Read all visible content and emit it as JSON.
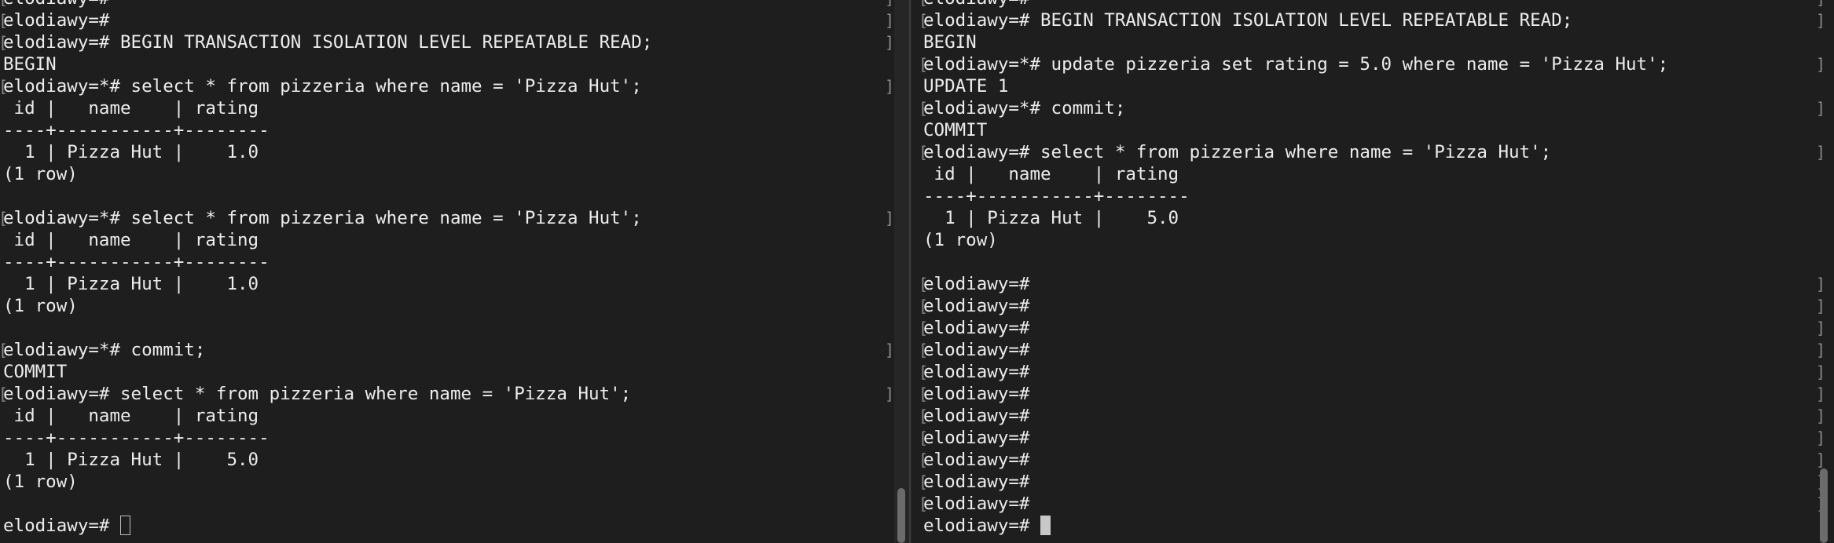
{
  "left_pane": {
    "lines": [
      {
        "text": "elodiawy=#",
        "br": "]"
      },
      {
        "text": "elodiawy=#",
        "br": "]"
      },
      {
        "text": "elodiawy=# BEGIN TRANSACTION ISOLATION LEVEL REPEATABLE READ;",
        "br": "]"
      },
      {
        "text": "BEGIN",
        "br": ""
      },
      {
        "text": "elodiawy=*# select * from pizzeria where name = 'Pizza Hut';",
        "br": "]"
      },
      {
        "text": " id |   name    | rating ",
        "br": ""
      },
      {
        "text": "----+-----------+--------",
        "br": ""
      },
      {
        "text": "  1 | Pizza Hut |    1.0",
        "br": ""
      },
      {
        "text": "(1 row)",
        "br": ""
      },
      {
        "text": "",
        "br": ""
      },
      {
        "text": "elodiawy=*# select * from pizzeria where name = 'Pizza Hut';",
        "br": "]"
      },
      {
        "text": " id |   name    | rating ",
        "br": ""
      },
      {
        "text": "----+-----------+--------",
        "br": ""
      },
      {
        "text": "  1 | Pizza Hut |    1.0",
        "br": ""
      },
      {
        "text": "(1 row)",
        "br": ""
      },
      {
        "text": "",
        "br": ""
      },
      {
        "text": "elodiawy=*# commit;",
        "br": "]"
      },
      {
        "text": "COMMIT",
        "br": ""
      },
      {
        "text": "elodiawy=# select * from pizzeria where name = 'Pizza Hut';",
        "br": "]"
      },
      {
        "text": " id |   name    | rating ",
        "br": ""
      },
      {
        "text": "----+-----------+--------",
        "br": ""
      },
      {
        "text": "  1 | Pizza Hut |    5.0",
        "br": ""
      },
      {
        "text": "(1 row)",
        "br": ""
      },
      {
        "text": "",
        "br": ""
      }
    ],
    "prompt": "elodiawy=# "
  },
  "right_pane": {
    "lines": [
      {
        "text": "elodiawy=#",
        "br": "]"
      },
      {
        "text": "elodiawy=# BEGIN TRANSACTION ISOLATION LEVEL REPEATABLE READ;",
        "br": "]"
      },
      {
        "text": "BEGIN",
        "br": ""
      },
      {
        "text": "elodiawy=*# update pizzeria set rating = 5.0 where name = 'Pizza Hut';",
        "br": "]"
      },
      {
        "text": "UPDATE 1",
        "br": ""
      },
      {
        "text": "elodiawy=*# commit;",
        "br": "]"
      },
      {
        "text": "COMMIT",
        "br": ""
      },
      {
        "text": "elodiawy=# select * from pizzeria where name = 'Pizza Hut';",
        "br": "]"
      },
      {
        "text": " id |   name    | rating ",
        "br": ""
      },
      {
        "text": "----+-----------+--------",
        "br": ""
      },
      {
        "text": "  1 | Pizza Hut |    5.0",
        "br": ""
      },
      {
        "text": "(1 row)",
        "br": ""
      },
      {
        "text": "",
        "br": ""
      },
      {
        "text": "elodiawy=#",
        "br": "]"
      },
      {
        "text": "elodiawy=#",
        "br": "]"
      },
      {
        "text": "elodiawy=#",
        "br": "]"
      },
      {
        "text": "elodiawy=#",
        "br": "]"
      },
      {
        "text": "elodiawy=#",
        "br": "]"
      },
      {
        "text": "elodiawy=#",
        "br": "]"
      },
      {
        "text": "elodiawy=#",
        "br": "]"
      },
      {
        "text": "elodiawy=#",
        "br": "]"
      },
      {
        "text": "elodiawy=#",
        "br": "]"
      },
      {
        "text": "elodiawy=#",
        "br": "]"
      },
      {
        "text": "elodiawy=#",
        "br": "]"
      }
    ],
    "prompt": "elodiawy=# "
  },
  "colors": {
    "background": "#1e1e1e",
    "foreground": "#ececec",
    "bracket": "#8a8a8a",
    "scrollbar": "#6b6b6b"
  }
}
